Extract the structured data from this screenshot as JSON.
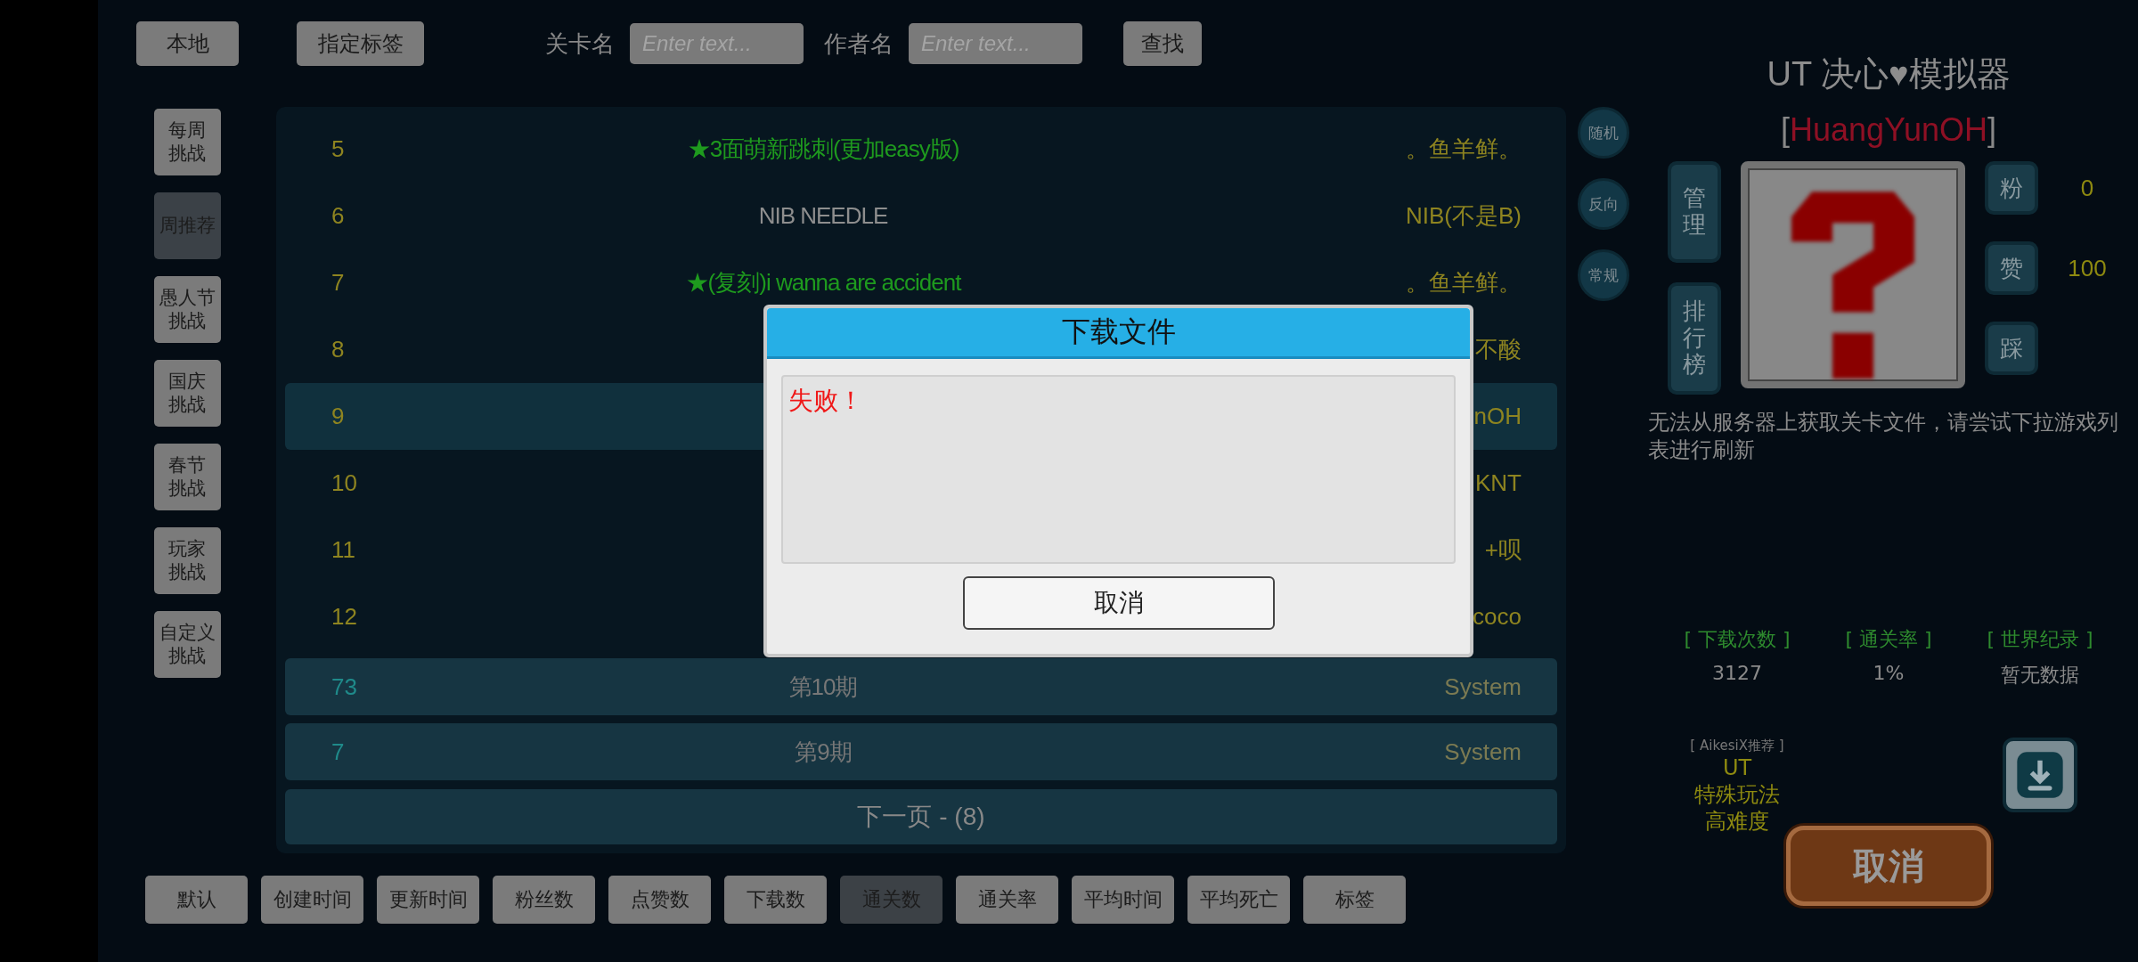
{
  "top_bar": {
    "local_button": "本地",
    "tag_button": "指定标签",
    "level_field": {
      "label": "关卡名",
      "placeholder": "Enter text..."
    },
    "author_field": {
      "label": "作者名",
      "placeholder": "Enter text..."
    },
    "search_button": "查找"
  },
  "sidebar": {
    "items": [
      {
        "lines": [
          "每周",
          "挑战"
        ],
        "selected": false
      },
      {
        "lines": [
          "周推荐"
        ],
        "selected": true
      },
      {
        "lines": [
          "愚人节",
          "挑战"
        ],
        "selected": false
      },
      {
        "lines": [
          "国庆",
          "挑战"
        ],
        "selected": false
      },
      {
        "lines": [
          "春节",
          "挑战"
        ],
        "selected": false
      },
      {
        "lines": [
          "玩家",
          "挑战"
        ],
        "selected": false
      },
      {
        "lines": [
          "自定义",
          "挑战"
        ],
        "selected": false
      }
    ]
  },
  "list": {
    "rows": [
      {
        "kind": "level",
        "number": "5",
        "title": "★3面萌新跳刺(更加easy版)",
        "featured": true,
        "author": "。鱼羊鲜。",
        "selected": false
      },
      {
        "kind": "level",
        "number": "6",
        "title": "NIB NEEDLE",
        "featured": false,
        "author": "NIB(不是B)",
        "selected": false
      },
      {
        "kind": "level",
        "number": "7",
        "title": "★(复刻)i wanna are accident",
        "featured": true,
        "author": "。鱼羊鲜。",
        "selected": false
      },
      {
        "kind": "level",
        "number": "8",
        "author": "不酸",
        "selected": false
      },
      {
        "kind": "level",
        "number": "9",
        "author": "nOH",
        "selected": true
      },
      {
        "kind": "level",
        "number": "10",
        "author": "KNT",
        "selected": false
      },
      {
        "kind": "level",
        "number": "11",
        "author": "+呗",
        "selected": false
      },
      {
        "kind": "level",
        "number": "12",
        "author": "coco",
        "selected": false
      },
      {
        "kind": "issue",
        "number": "73",
        "title": "第10期",
        "author": "System",
        "selected": false
      },
      {
        "kind": "issue",
        "number": "7",
        "title": "第9期",
        "author": "System",
        "selected": false
      }
    ],
    "next_page": "下一页 - (8)"
  },
  "mode_buttons": [
    "随机",
    "反向",
    "常规"
  ],
  "profile": {
    "title": "UT 决心♥模拟器",
    "name_open": "[",
    "name": "HuangYunOH",
    "name_close": "]",
    "side_buttons": [
      "管理",
      "排行榜"
    ],
    "counters": [
      {
        "label": "粉",
        "value": "0"
      },
      {
        "label": "赞",
        "value": "100"
      },
      {
        "label": "踩"
      }
    ],
    "message": "无法从服务器上获取关卡文件，请尝试下拉游戏列表进行刷新",
    "stats": [
      {
        "label": "[ 下载次数 ]",
        "value": "3127"
      },
      {
        "label": "[ 通关率 ]",
        "value": "1%"
      },
      {
        "label": "[ 世界纪录 ]",
        "value": "暂无数据"
      }
    ],
    "recommend": {
      "label": "[ AikesiX推荐 ]",
      "tags": [
        "UT",
        "特殊玩法",
        "高难度"
      ]
    },
    "cancel_button": "取消"
  },
  "sort_buttons": [
    {
      "label": "默认",
      "selected": false
    },
    {
      "label": "创建时间",
      "selected": false
    },
    {
      "label": "更新时间",
      "selected": false
    },
    {
      "label": "粉丝数",
      "selected": false
    },
    {
      "label": "点赞数",
      "selected": false
    },
    {
      "label": "下载数",
      "selected": false
    },
    {
      "label": "通关数",
      "selected": true
    },
    {
      "label": "通关率",
      "selected": false
    },
    {
      "label": "平均时间",
      "selected": false
    },
    {
      "label": "平均死亡",
      "selected": false
    },
    {
      "label": "标签",
      "selected": false
    }
  ],
  "dialog": {
    "title": "下载文件",
    "message": "失败！",
    "button": "取消"
  }
}
